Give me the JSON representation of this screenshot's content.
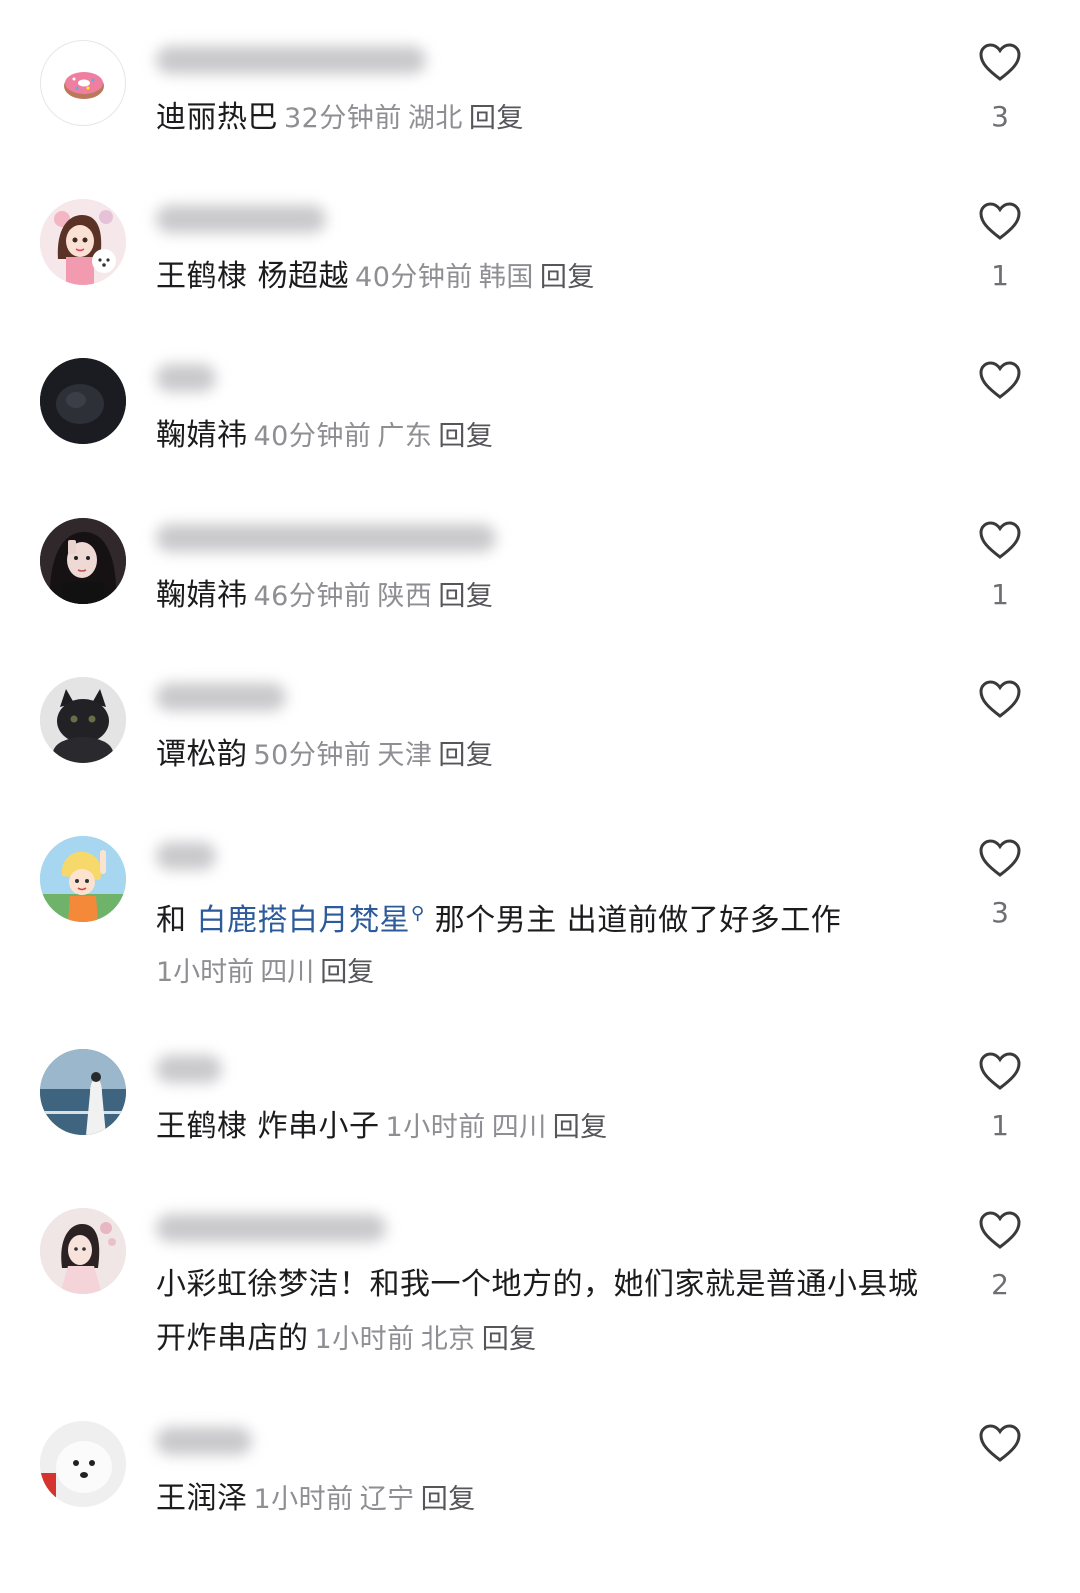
{
  "comments": [
    {
      "avatar": "donut-avatar",
      "text": "迪丽热巴",
      "time": "32分钟前",
      "region": "湖北",
      "reply": "回复",
      "likes": "3"
    },
    {
      "avatar": "cartoon-girl-dog-avatar",
      "text": "王鹤棣 杨超越",
      "time": "40分钟前",
      "region": "韩国",
      "reply": "回复",
      "likes": "1"
    },
    {
      "avatar": "dark-pet-avatar",
      "text": "鞠婧祎",
      "time": "40分钟前",
      "region": "广东",
      "reply": "回复",
      "likes": ""
    },
    {
      "avatar": "girl-selfie-avatar",
      "text": "鞠婧祎",
      "time": "46分钟前",
      "region": "陕西",
      "reply": "回复",
      "likes": "1"
    },
    {
      "avatar": "black-cat-avatar",
      "text": "谭松韵",
      "time": "50分钟前",
      "region": "天津",
      "reply": "回复",
      "likes": ""
    },
    {
      "avatar": "anime-kid-avatar",
      "text_prefix": "和 ",
      "topic": "白鹿搭白月梵星",
      "text_suffix": " 那个男主 出道前做了好多工作",
      "time": "1小时前",
      "region": "四川",
      "reply": "回复",
      "likes": "3"
    },
    {
      "avatar": "sea-girl-avatar",
      "text": "王鹤棣 炸串小子",
      "time": "1小时前",
      "region": "四川",
      "reply": "回复",
      "likes": "1"
    },
    {
      "avatar": "hanfu-girl-avatar",
      "text": "小彩虹徐梦洁！和我一个地方的，她们家就是普通小县城开炸串店的",
      "time": "1小时前",
      "region": "北京",
      "reply": "回复",
      "likes": "2"
    },
    {
      "avatar": "white-dog-avatar",
      "text": "王润泽",
      "time": "1小时前",
      "region": "辽宁",
      "reply": "回复",
      "likes": ""
    }
  ],
  "icons": {
    "like": "heart-outline-icon",
    "topic_search": "search-icon"
  },
  "colors": {
    "text": "#1c1c1e",
    "meta": "#8e8e93",
    "topic_link": "#2c5a9a",
    "like_count": "#6e6e73"
  }
}
